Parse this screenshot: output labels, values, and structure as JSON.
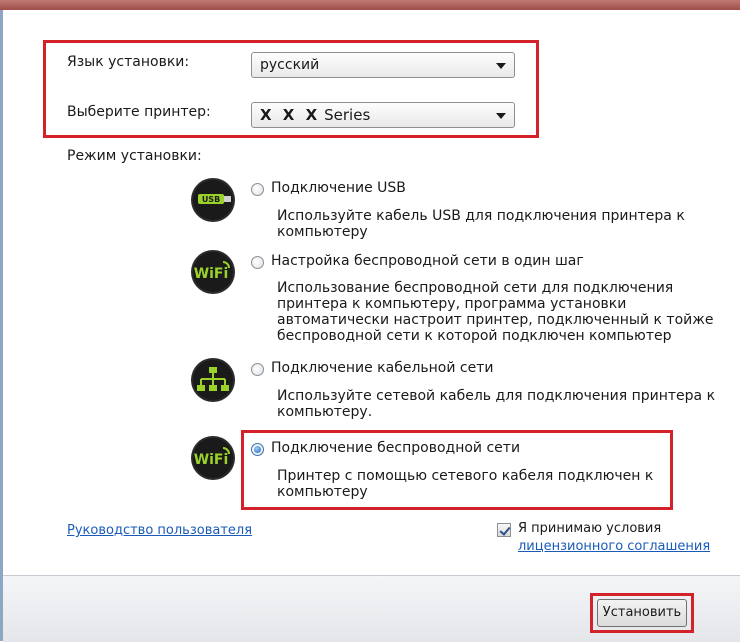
{
  "language": {
    "label": "Язык установки:",
    "value": "русский"
  },
  "printer": {
    "label": "Выберите принтер:",
    "value_prefix": "X X X",
    "value_suffix": "Series"
  },
  "install_mode": {
    "label": "Режим установки:",
    "options": [
      {
        "icon": "usb-icon",
        "title": "Подключение USB",
        "desc": [
          "Используйте кабель USB для подключения принтера к",
          "компьютеру"
        ],
        "selected": false
      },
      {
        "icon": "wifi-icon",
        "title": "Настройка беспроводной сети в один шаг",
        "desc": [
          "Использование беспроводной сети для подключения",
          "принтера к компьютеру, программа установки",
          "автоматически настроит принтер, подключенный к тойже",
          "беспроводной сети к которой подключен компьютер"
        ],
        "selected": false
      },
      {
        "icon": "network-icon",
        "title": "Подключение кабельной сети",
        "desc": [
          "Используйте сетевой кабель для подключения принтера к",
          "компьютеру."
        ],
        "selected": false
      },
      {
        "icon": "wifi-icon",
        "title": "Подключение беспроводной сети",
        "desc": [
          "Принтер с помощью сетевого кабеля подключен к",
          "компьютеру"
        ],
        "selected": true
      }
    ]
  },
  "user_guide_link": "Руководство пользователя",
  "license": {
    "checked": true,
    "text": "Я принимаю условия",
    "link": "лицензионного соглашения"
  },
  "install_button": "Установить",
  "icon_labels": {
    "usb": "USB",
    "wifi": "WiFi"
  },
  "colors": {
    "highlight": "#d3222a",
    "link": "#1a5bb8",
    "icon_green": "#9bd22a"
  }
}
